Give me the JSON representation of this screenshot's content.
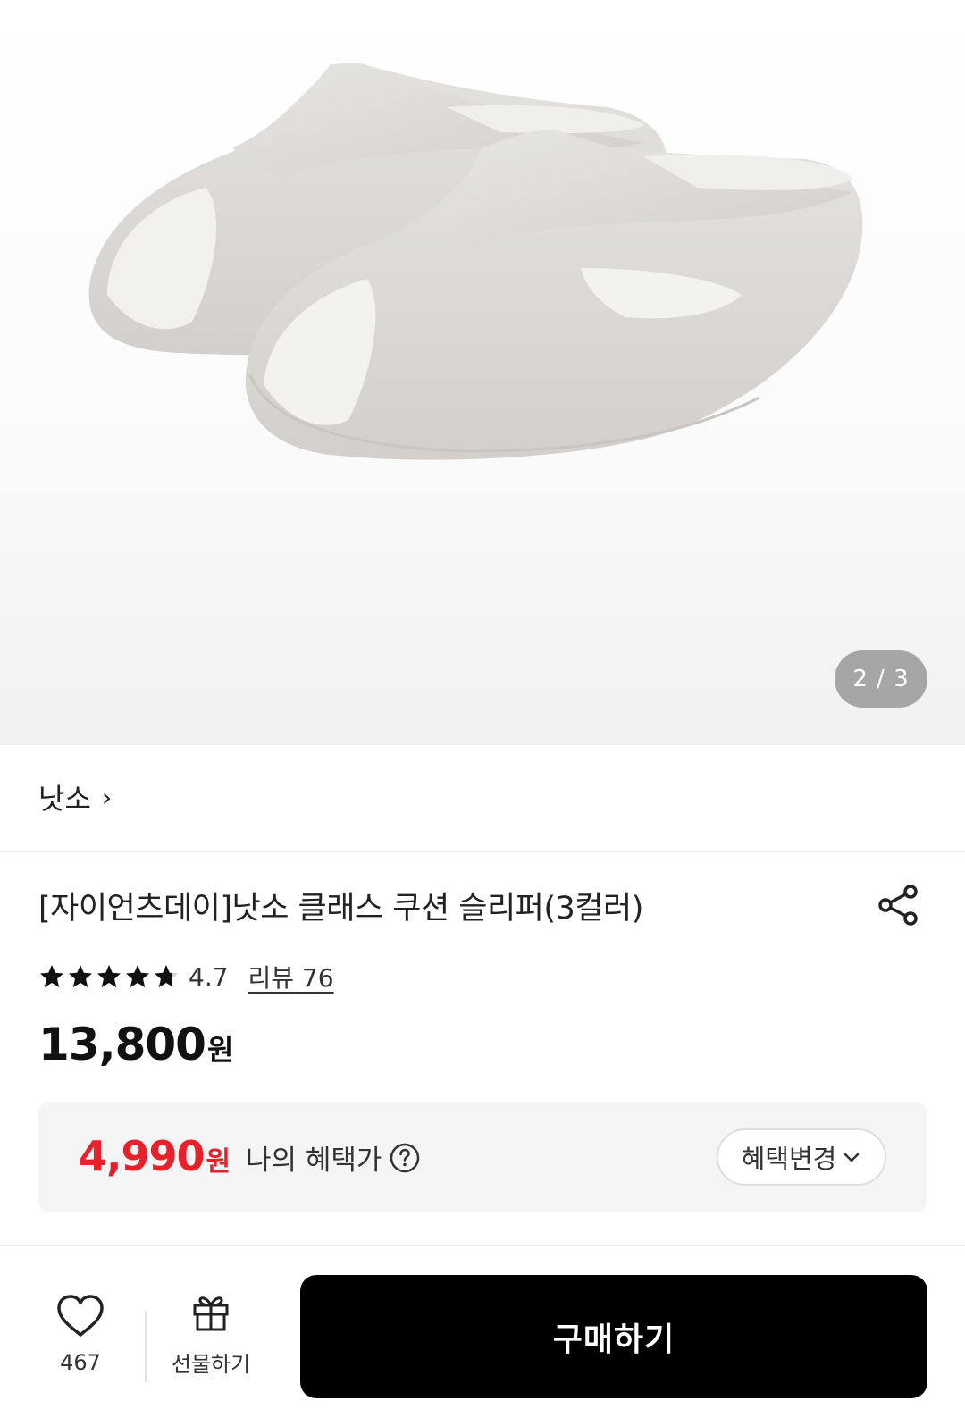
{
  "gallery": {
    "image_alt": "product-image-slippers",
    "pager_text": "2 / 3",
    "current": 2,
    "total": 3
  },
  "brand": {
    "name": "낫소",
    "chevron": "›"
  },
  "product": {
    "title": "[자이언츠데이]낫소 클래스 쿠션 슬리퍼(3컬러)",
    "share_icon": "share-icon"
  },
  "rating": {
    "stars": 4.7,
    "score_text": "4.7",
    "review_text": "리뷰 76"
  },
  "price": {
    "amount": "13,800",
    "unit": "원"
  },
  "benefit": {
    "amount": "4,990",
    "unit": "원",
    "label": "나의 혜택가",
    "help_icon": "question-circle-icon",
    "change_label": "혜택변경",
    "accent": "#e8202a"
  },
  "bottom_bar": {
    "wish_count": "467",
    "gift_label": "선물하기",
    "buy_label": "구매하기",
    "buy_color": "#000000"
  }
}
